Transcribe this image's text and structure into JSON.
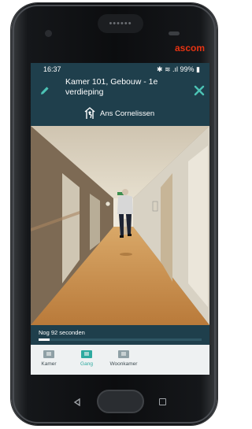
{
  "device": {
    "brand": "ascom",
    "speaker_dots": "••••••"
  },
  "statusbar": {
    "time": "16:37",
    "indicators": "✱ ≋ .ıl 99% ▮"
  },
  "header": {
    "title": "Kamer 101, Gebouw - 1e verdieping",
    "resident": "Ans Cornelissen",
    "edit_icon": "pencil-icon",
    "close_icon": "close-icon"
  },
  "video": {
    "description_icon": "camera-feed"
  },
  "playback": {
    "countdown_text": "Nog 92 seconden",
    "progress_fraction": 0.07
  },
  "tabs": [
    {
      "label": "Kamer",
      "active": false
    },
    {
      "label": "Gang",
      "active": true
    },
    {
      "label": "Woonkamer",
      "active": false
    }
  ],
  "colors": {
    "header_bg": "#1f3f4c",
    "accent": "#2eaaa0",
    "brand": "#e63312"
  }
}
